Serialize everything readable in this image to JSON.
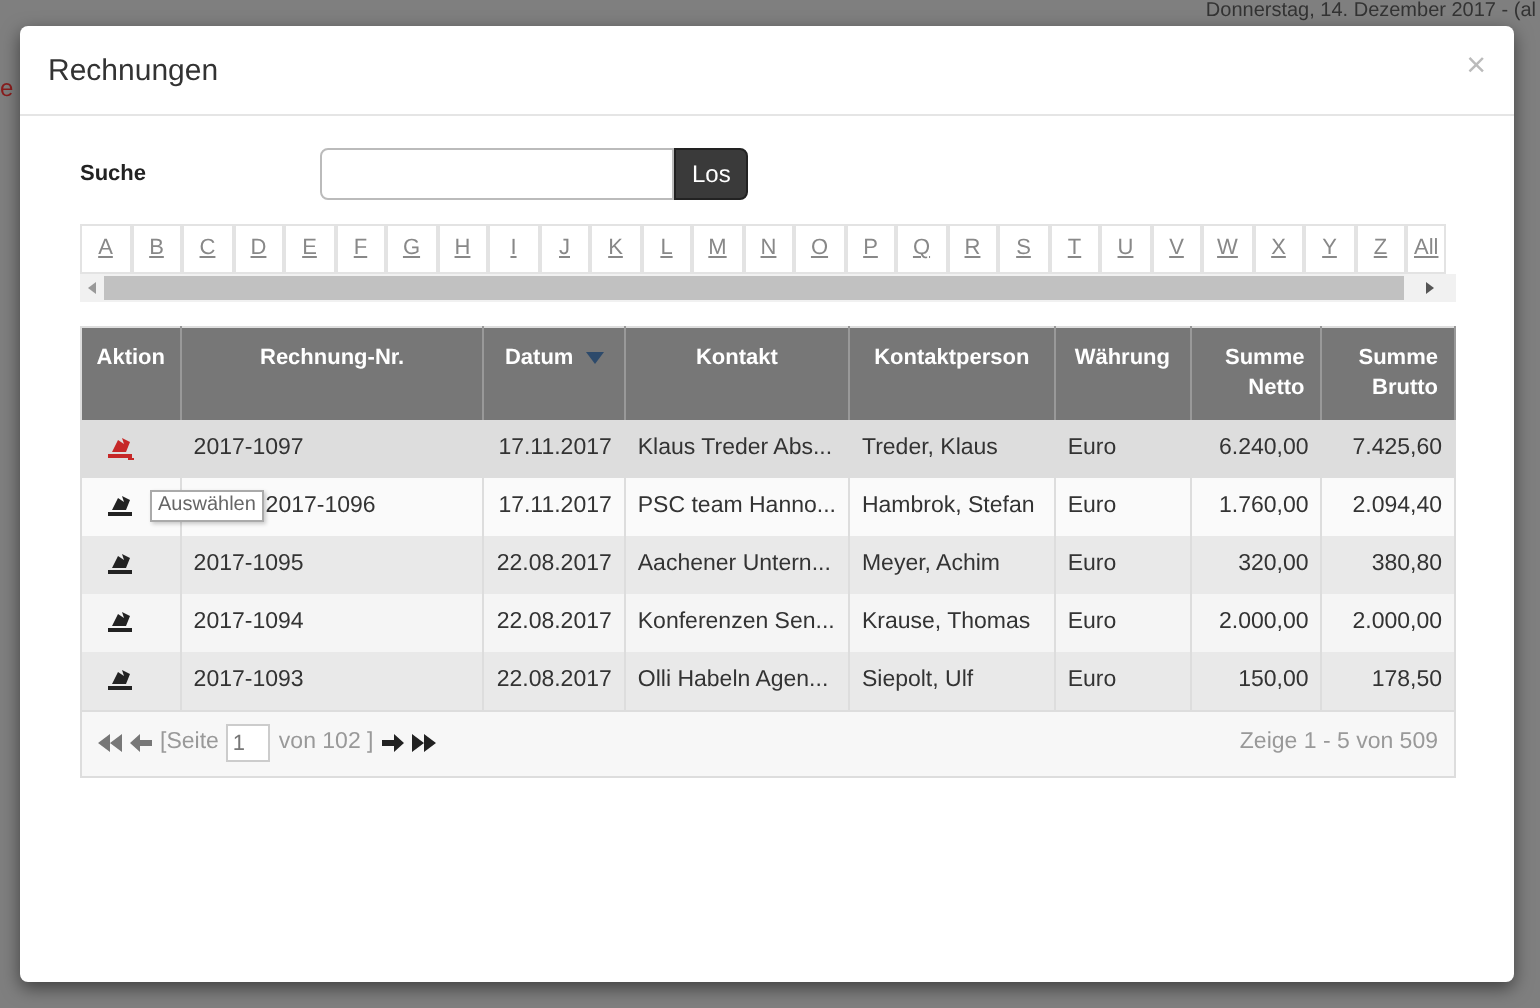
{
  "background": {
    "date_text": "Donnerstag, 14. Dezember 2017 - (al",
    "side_text": "e"
  },
  "dialog": {
    "title": "Rechnungen",
    "close": "×"
  },
  "search": {
    "label": "Suche",
    "button": "Los"
  },
  "letters": [
    {
      "label": "A"
    },
    {
      "label": "B"
    },
    {
      "label": "C"
    },
    {
      "label": "D"
    },
    {
      "label": "E"
    },
    {
      "label": "F"
    },
    {
      "label": "G"
    },
    {
      "label": "H"
    },
    {
      "label": "I"
    },
    {
      "label": "J"
    },
    {
      "label": "K"
    },
    {
      "label": "L"
    },
    {
      "label": "M"
    },
    {
      "label": "N"
    },
    {
      "label": "O"
    },
    {
      "label": "P"
    },
    {
      "label": "Q"
    },
    {
      "label": "R"
    },
    {
      "label": "S"
    },
    {
      "label": "T"
    },
    {
      "label": "U"
    },
    {
      "label": "V"
    },
    {
      "label": "W"
    },
    {
      "label": "X"
    },
    {
      "label": "Y"
    },
    {
      "label": "Z"
    },
    {
      "label": "All"
    }
  ],
  "table": {
    "columns": [
      {
        "label": "Aktion",
        "sorted": false
      },
      {
        "label": "Rechnung-Nr.",
        "sorted": false
      },
      {
        "label": "Datum",
        "sorted": true
      },
      {
        "label": "Kontakt",
        "sorted": false
      },
      {
        "label": "Kontaktperson",
        "sorted": false
      },
      {
        "label": "Währung",
        "sorted": false
      },
      {
        "label": "Summe Netto",
        "sorted": false
      },
      {
        "label": "Summe Brutto",
        "sorted": false
      }
    ],
    "rows": [
      {
        "highlighted": true,
        "cells": [
          "",
          "2017-1097",
          "17.11.2017",
          "Klaus Treder Abs...",
          "Treder, Klaus",
          "Euro",
          "6.240,00",
          "7.425,60"
        ]
      },
      {
        "highlighted": false,
        "tooltip": "Auswählen",
        "cells": [
          "",
          "2017-1096",
          "17.11.2017",
          "PSC team Hanno...",
          "Hambrok, Stefan",
          "Euro",
          "1.760,00",
          "2.094,40"
        ]
      },
      {
        "highlighted": false,
        "cells": [
          "",
          "2017-1095",
          "22.08.2017",
          "Aachener Untern...",
          "Meyer, Achim",
          "Euro",
          "320,00",
          "380,80"
        ]
      },
      {
        "highlighted": false,
        "cells": [
          "",
          "2017-1094",
          "22.08.2017",
          "Konferenzen Sen...",
          "Krause, Thomas",
          "Euro",
          "2.000,00",
          "2.000,00"
        ]
      },
      {
        "highlighted": false,
        "cells": [
          "",
          "2017-1093",
          "22.08.2017",
          "Olli Habeln Agen...",
          "Siepolt, Ulf",
          "Euro",
          "150,00",
          "178,50"
        ]
      }
    ]
  },
  "pager": {
    "page_prefix": "[Seite",
    "page": "1",
    "page_suffix": "von 102 ]",
    "summary": "Zeige 1 - 5 von 509"
  }
}
